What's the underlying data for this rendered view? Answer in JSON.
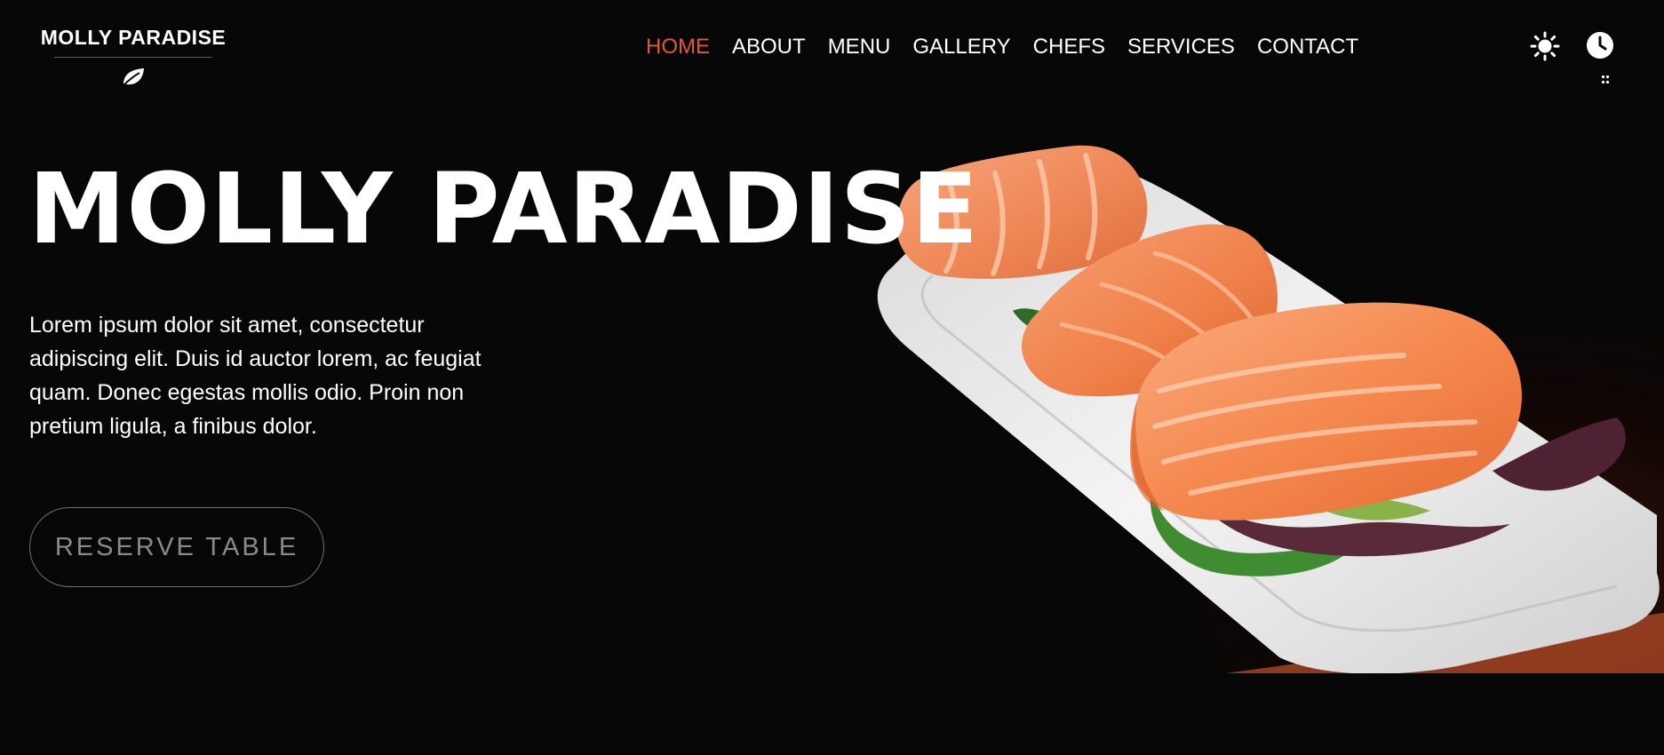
{
  "header": {
    "logo": {
      "text": "MOLLY PARADISE",
      "emblem_icon": "leaf-icon"
    },
    "nav": [
      {
        "label": "HOME",
        "active": true
      },
      {
        "label": "ABOUT",
        "active": false
      },
      {
        "label": "MENU",
        "active": false
      },
      {
        "label": "GALLERY",
        "active": false
      },
      {
        "label": "CHEFS",
        "active": false
      },
      {
        "label": "SERVICES",
        "active": false
      },
      {
        "label": "CONTACT",
        "active": false
      }
    ],
    "utility_icons": [
      "sun-icon",
      "clock-icon",
      "menu-dots-icon"
    ]
  },
  "hero": {
    "title": "MOLLY PARADISE",
    "description": "Lorem ipsum dolor sit amet, consectetur adipiscing elit. Duis id auctor lorem, ac feugiat quam. Donec egestas mollis odio. Proin non pretium ligula, a finibus dolor.",
    "cta_label": "RESERVE TABLE",
    "image_subject": "salmon fillets on white plate"
  },
  "colors": {
    "background": "#070707",
    "accent": "#e8542e",
    "text": "#ffffff",
    "button_text": "#8a8a8a"
  }
}
